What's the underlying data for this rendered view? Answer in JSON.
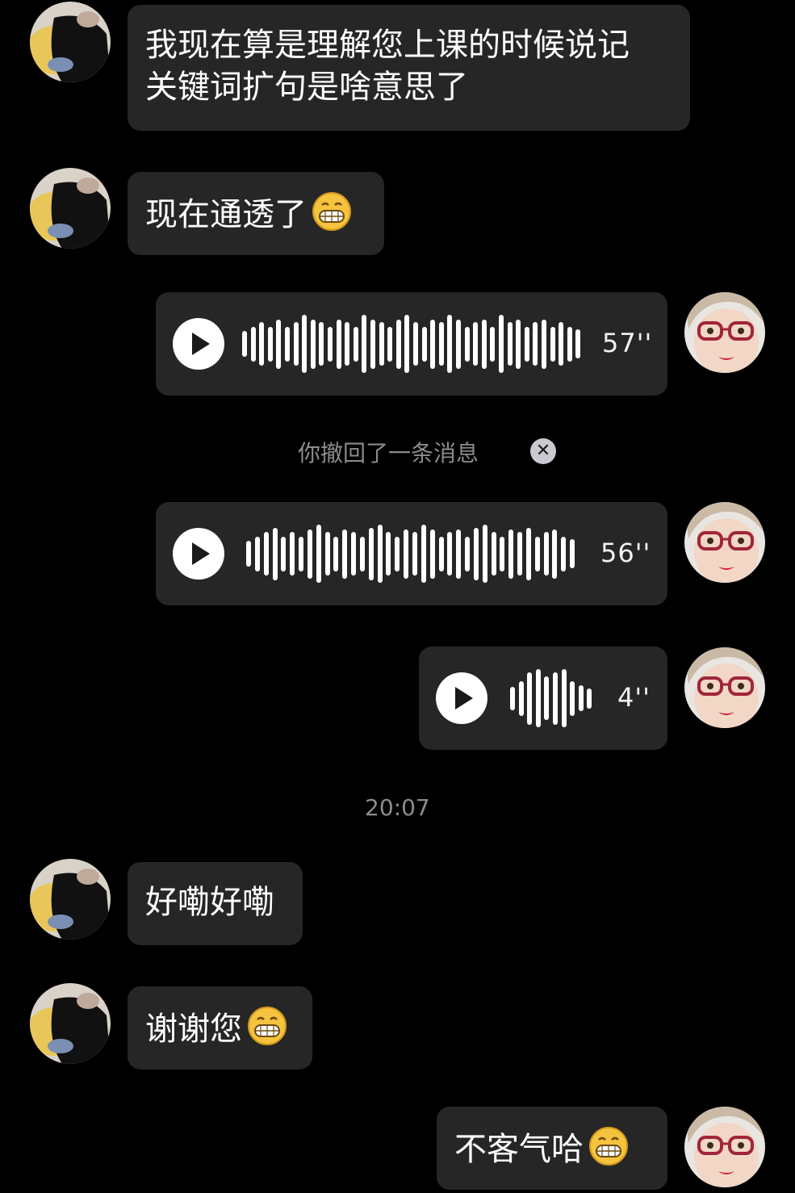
{
  "messages": {
    "m1": {
      "text": "我现在算是理解您上课的时候说记\n关键词扩句是啥意思了"
    },
    "m2": {
      "text": "现在通透了"
    },
    "v1": {
      "duration": "57''"
    },
    "recall": {
      "text": "你撤回了一条消息"
    },
    "v2": {
      "duration": "56''"
    },
    "v3": {
      "duration": "4''"
    },
    "time": {
      "text": "20:07"
    },
    "m3": {
      "text": "好嘞好嘞"
    },
    "m4": {
      "text": "谢谢您"
    },
    "m5": {
      "text": "不客气哈"
    }
  },
  "icons": {
    "emoji": "grinning-face-icon",
    "play": "play-icon",
    "close": "close-icon"
  },
  "colors": {
    "background": "#000000",
    "bubble": "#262626",
    "system_text": "#8c8c8c"
  }
}
